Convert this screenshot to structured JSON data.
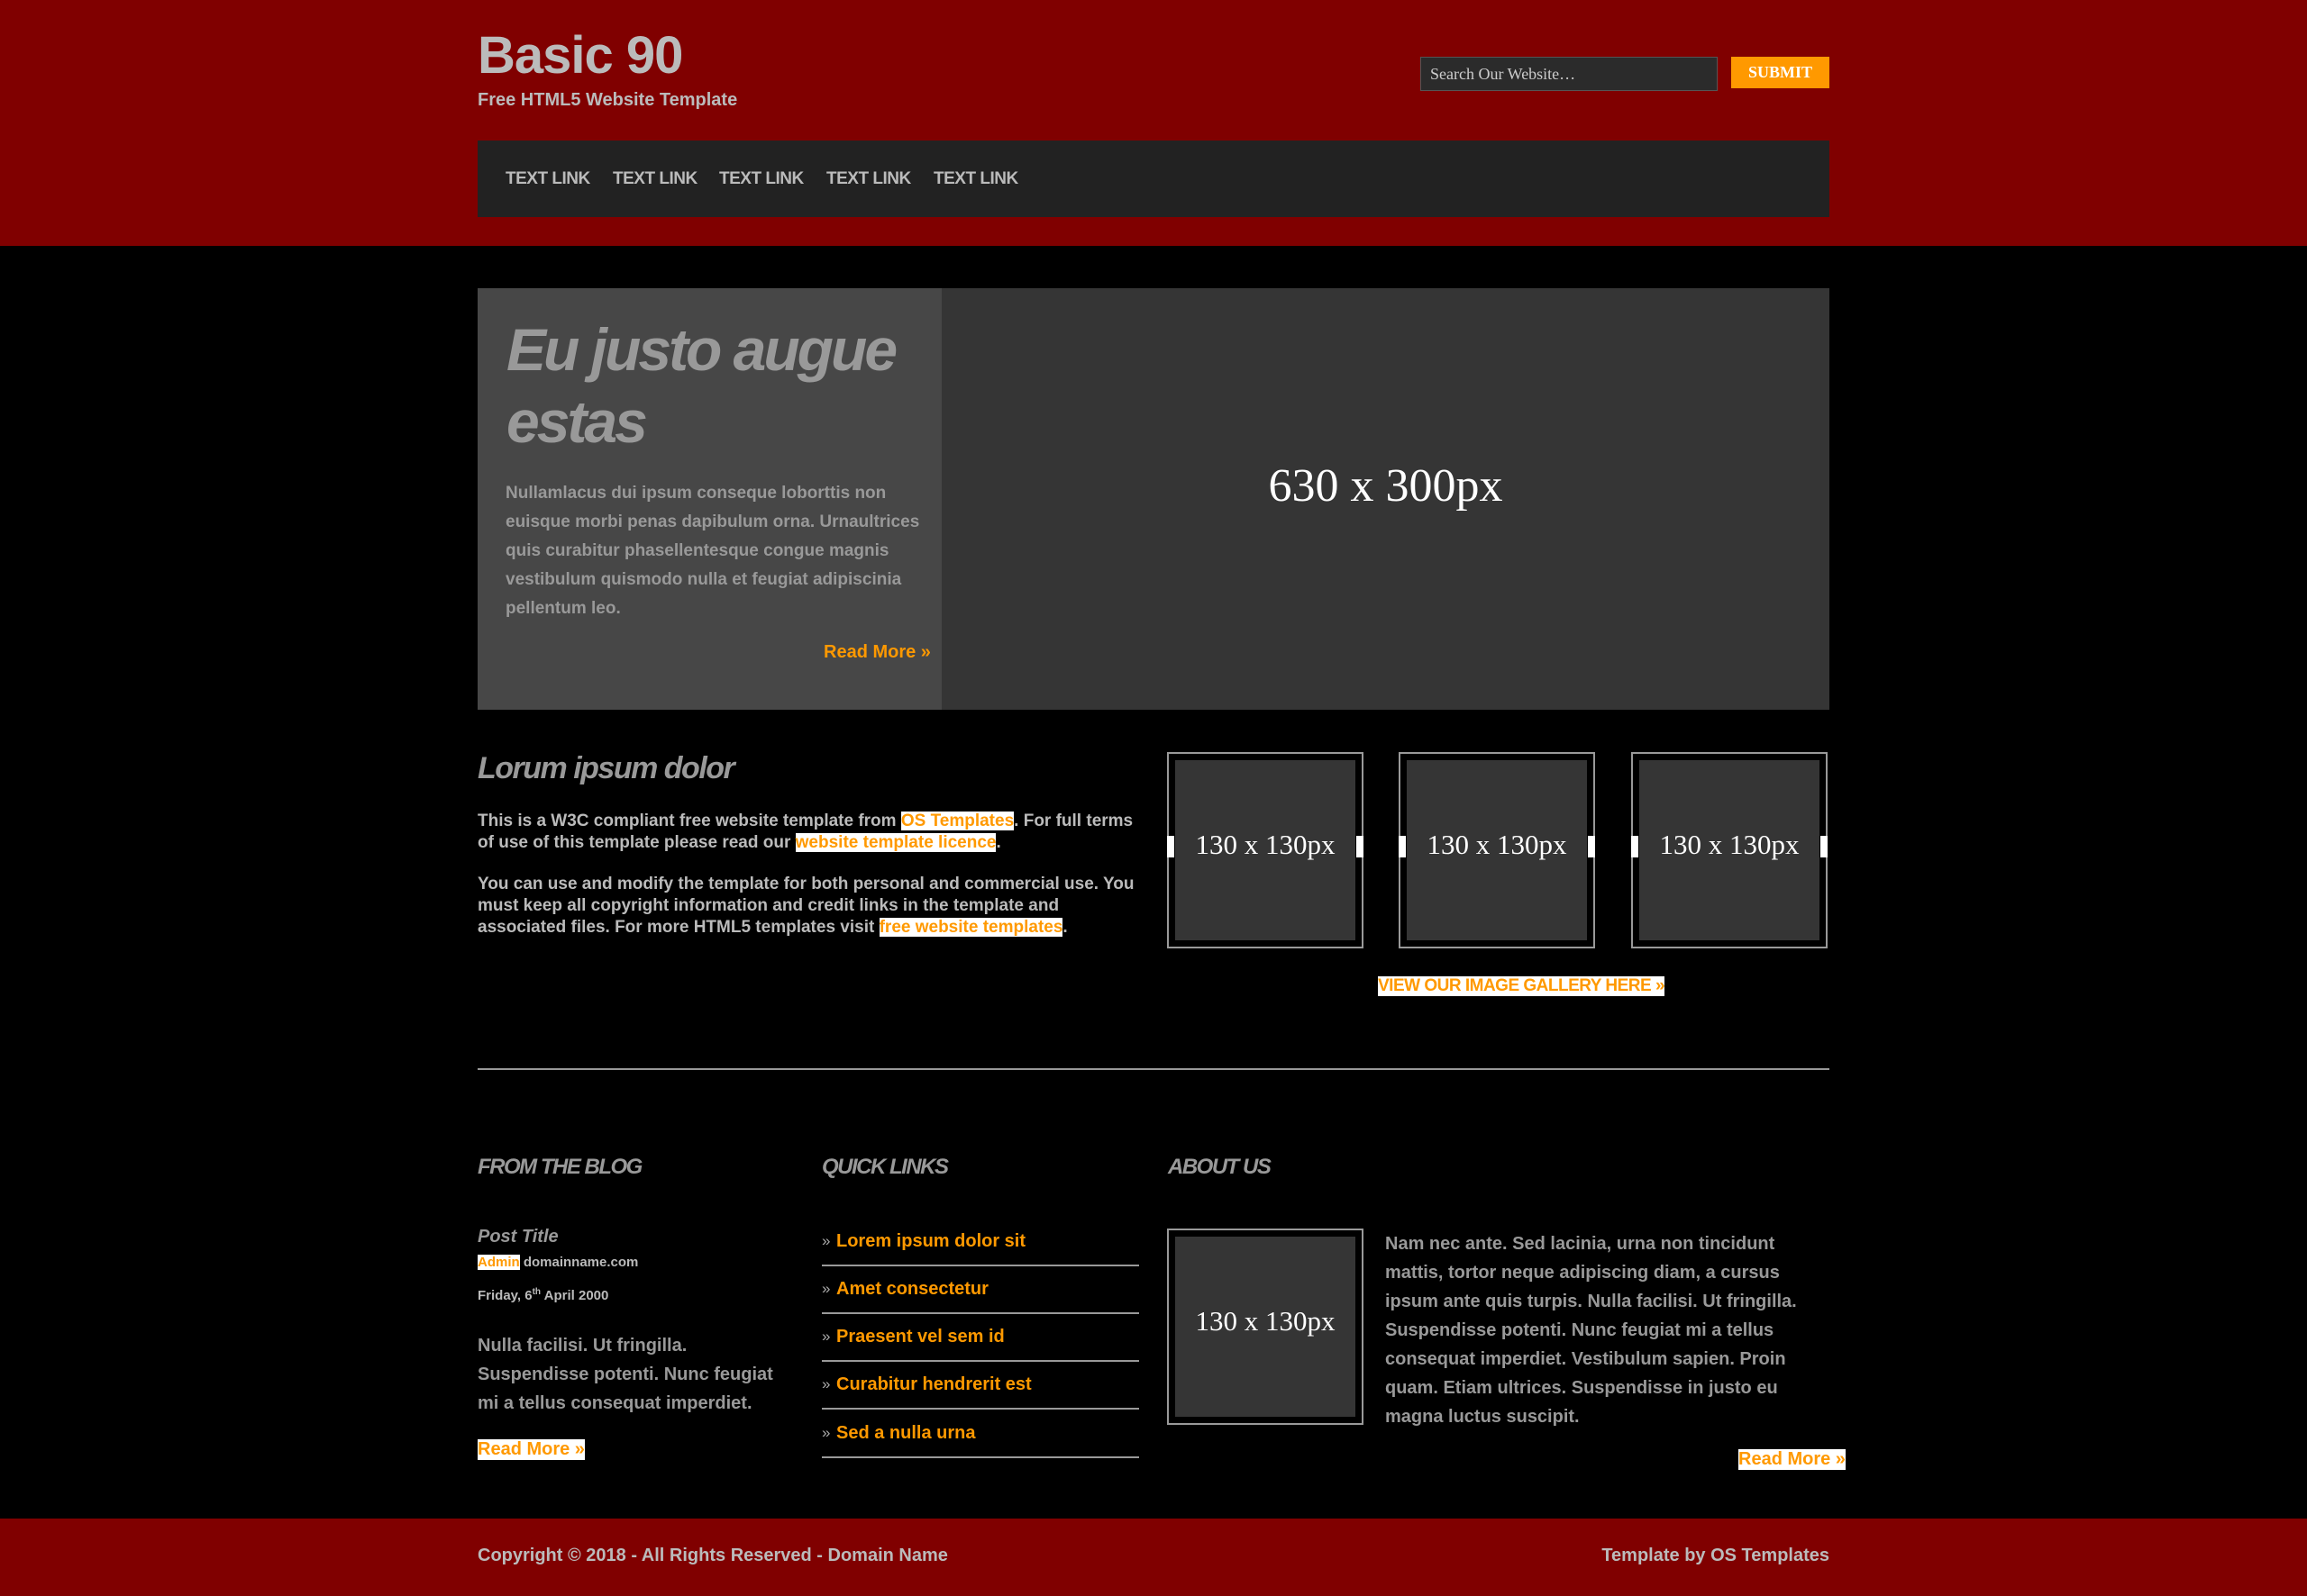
{
  "colors": {
    "header_bg": "#800000",
    "nav_bg": "#222222",
    "page_bg": "#000000",
    "accent": "#FF9900",
    "panel_bg": "#474747",
    "image_bg": "#353535"
  },
  "header": {
    "title": "Basic 90",
    "subtitle": "Free HTML5 Website Template"
  },
  "search": {
    "placeholder": "Search Our Website…",
    "button_label": "SUBMIT"
  },
  "nav": {
    "items": [
      "TEXT LINK",
      "TEXT LINK",
      "TEXT LINK",
      "TEXT LINK",
      "TEXT LINK"
    ]
  },
  "featured": {
    "title": "Eu justo augue estas",
    "body": "Nullamlacus dui ipsum conseque loborttis non euisque morbi penas dapibulum orna. Urnaultrices quis curabitur phasellentesque congue magnis vestibulum quismodo nulla et feugiat adipiscinia pellentum leo.",
    "read_more": "Read More »",
    "image_label": "630 x 300px"
  },
  "intro": {
    "title": "Lorum ipsum dolor",
    "p1_a": "This is a W3C compliant free website template from ",
    "p1_link1": "OS Templates",
    "p1_b": ". For full terms of use of this template please read our ",
    "p1_link2": "website template licence",
    "p1_c": ".",
    "p2_a": "You can use and modify the template for both personal and commercial use. You must keep all copyright information and credit links in the template and associated files. For more HTML5 templates visit ",
    "p2_link": "free website templates",
    "p2_b": "."
  },
  "gallery": {
    "thumbs": [
      "130 x 130px",
      "130 x 130px",
      "130 x 130px"
    ],
    "link": "VIEW OUR IMAGE GALLERY HERE »"
  },
  "blog": {
    "heading": "FROM THE BLOG",
    "post_title": "Post Title",
    "author": "Admin",
    "domain": "domainname.com",
    "date_prefix": "Friday, 6",
    "date_sup": "th",
    "date_suffix": " April 2000",
    "body": "Nulla facilisi. Ut fringilla. Suspendisse potenti. Nunc feugiat mi a tellus consequat imperdiet.",
    "read_more": "Read More »"
  },
  "quick_links": {
    "heading": "QUICK LINKS",
    "chevron": "»",
    "items": [
      "Lorem ipsum dolor sit",
      "Amet consectetur",
      "Praesent vel sem id",
      "Curabitur hendrerit est",
      "Sed a nulla urna"
    ]
  },
  "about": {
    "heading": "ABOUT US",
    "image_label": "130 x 130px",
    "body": "Nam nec ante. Sed lacinia, urna non tincidunt mattis, tortor neque adipiscing diam, a cursus ipsum ante quis turpis. Nulla facilisi. Ut fringilla. Suspendisse potenti. Nunc feugiat mi a tellus consequat imperdiet. Vestibulum sapien. Proin quam. Etiam ultrices. Suspendisse in justo eu magna luctus suscipit.",
    "read_more": "Read More »"
  },
  "footer": {
    "copyright": "Copyright © 2018 - All Rights Reserved - Domain Name",
    "credit": "Template by OS Templates"
  }
}
